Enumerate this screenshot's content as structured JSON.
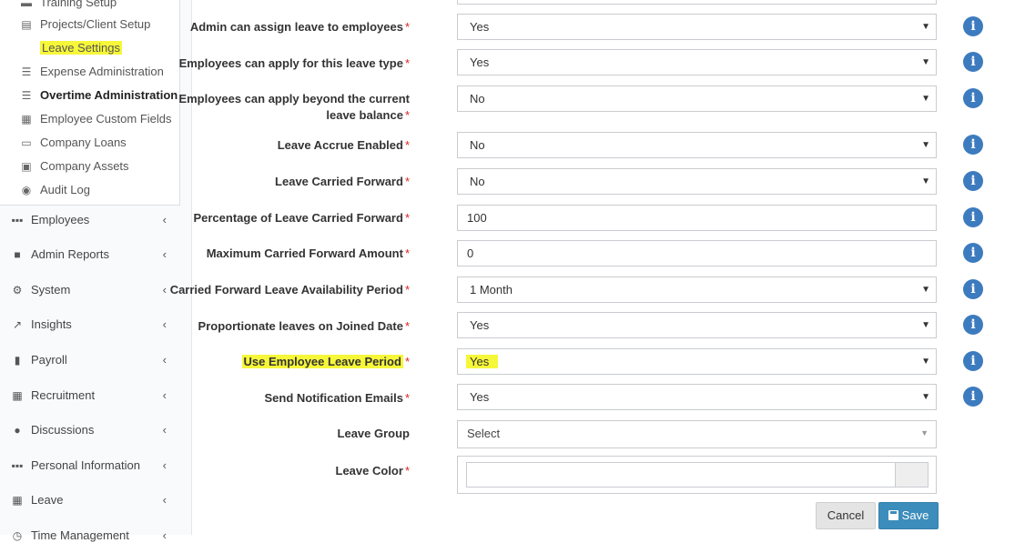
{
  "sidebar": {
    "sub_items": [
      {
        "label": "Training Setup",
        "icon": "briefcase-icon"
      },
      {
        "label": "Projects/Client Setup",
        "icon": "list-icon"
      },
      {
        "label": "Leave Settings",
        "icon": "none"
      },
      {
        "label": "Expense Administration",
        "icon": "bars-icon"
      },
      {
        "label": "Overtime Administration",
        "icon": "bars-icon"
      },
      {
        "label": "Employee Custom Fields",
        "icon": "table-icon"
      },
      {
        "label": "Company Loans",
        "icon": "card-icon"
      },
      {
        "label": "Company Assets",
        "icon": "archive-icon"
      },
      {
        "label": "Audit Log",
        "icon": "compass-icon"
      }
    ],
    "nav_items": [
      {
        "label": "Employees",
        "icon": "grid-icon"
      },
      {
        "label": "Admin Reports",
        "icon": "cubes-icon"
      },
      {
        "label": "System",
        "icon": "cogs-icon"
      },
      {
        "label": "Insights",
        "icon": "chart-icon"
      },
      {
        "label": "Payroll",
        "icon": "file-icon"
      },
      {
        "label": "Recruitment",
        "icon": "grid-icon"
      },
      {
        "label": "Discussions",
        "icon": "comments-icon"
      },
      {
        "label": "Personal Information",
        "icon": "grid-icon"
      },
      {
        "label": "Leave",
        "icon": "calendar-icon"
      },
      {
        "label": "Time Management",
        "icon": "clock-icon"
      }
    ],
    "chevron": "‹"
  },
  "form": {
    "required_mark": "*",
    "arrow": "▼",
    "info_glyph": "i",
    "rows": [
      {
        "label": "Admin can assign leave to employees",
        "value": "Yes"
      },
      {
        "label": "Employees can apply for this leave type",
        "value": "Yes"
      },
      {
        "label": "Employees can apply beyond the current leave balance",
        "value": "No"
      },
      {
        "label": "Leave Accrue Enabled",
        "value": "No"
      },
      {
        "label": "Leave Carried Forward",
        "value": "No"
      },
      {
        "label": "Percentage of Leave Carried Forward",
        "value": "100"
      },
      {
        "label": "Maximum Carried Forward Amount",
        "value": "0"
      },
      {
        "label": "Carried Forward Leave Availability Period",
        "value": "1 Month"
      },
      {
        "label": "Proportionate leaves on Joined Date",
        "value": "Yes"
      },
      {
        "label": "Use Employee Leave Period",
        "value": "Yes"
      },
      {
        "label": "Send Notification Emails",
        "value": "Yes"
      },
      {
        "label": "Leave Group",
        "value": "Select"
      },
      {
        "label": "Leave Color",
        "value": ""
      }
    ]
  },
  "buttons": {
    "cancel": "Cancel",
    "save": "Save"
  },
  "colors": {
    "highlight": "#f7f73a",
    "primary": "#3c8dbc",
    "info": "#3d7bbf",
    "required": "#dd2222"
  }
}
